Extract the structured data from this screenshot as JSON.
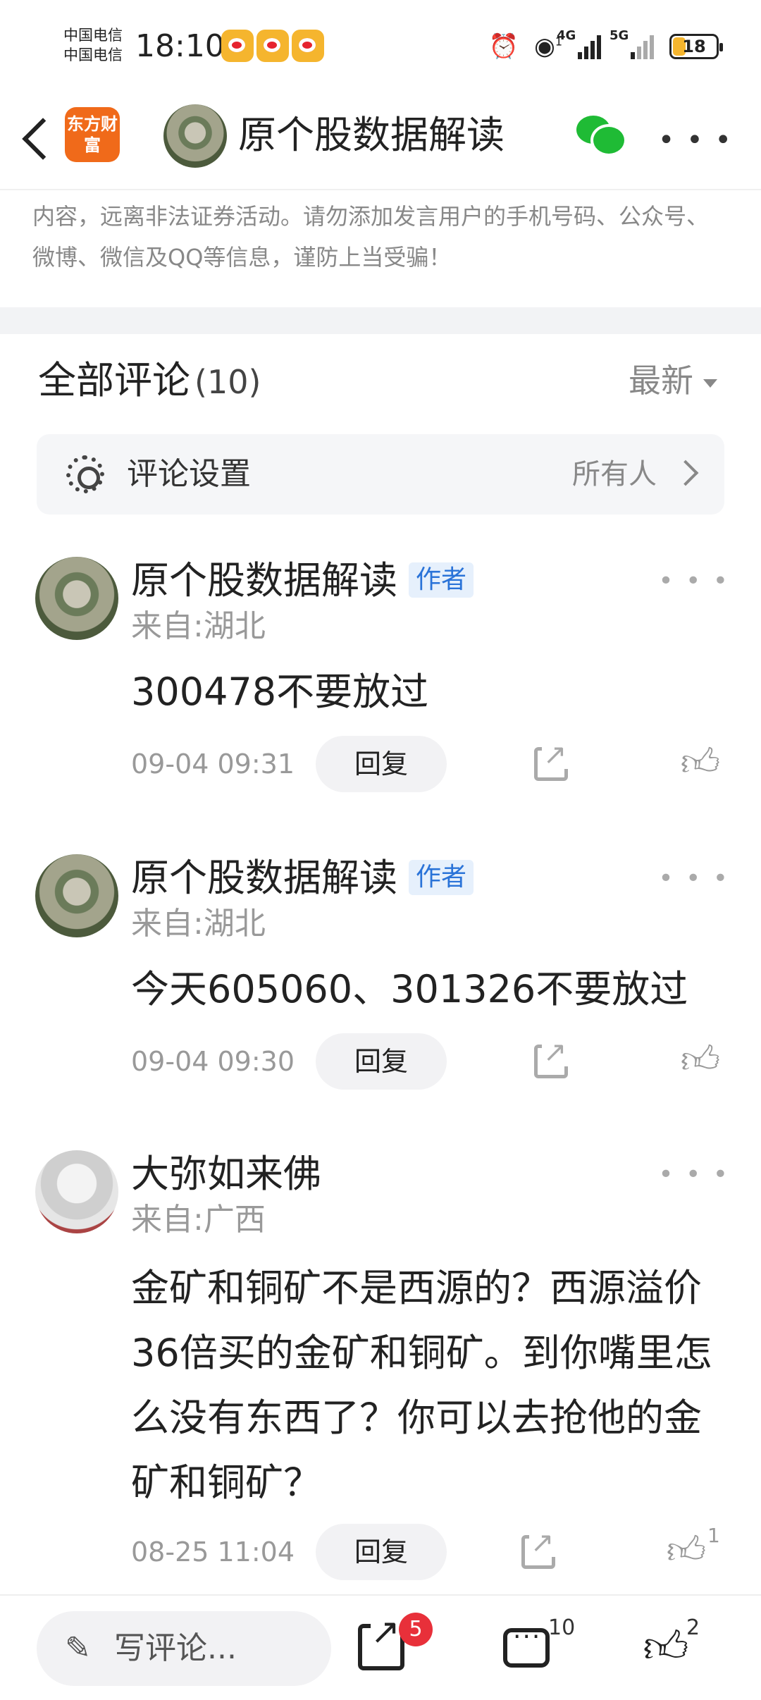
{
  "status_bar": {
    "carrier_1": "中国电信",
    "carrier_2": "中国电信",
    "time": "18:10",
    "signal_1": "4G",
    "signal_2": "5G",
    "hotspot_count": "1",
    "battery": "18"
  },
  "header": {
    "app_logo_text": "东方财富",
    "title": "原个股数据解读"
  },
  "notice": "内容，远离非法证券活动。请勿添加发言用户的手机号码、公众号、微博、微信及QQ等信息，谨防上当受骗！",
  "comments_header": {
    "title": "全部评论",
    "count": "(10)",
    "sort_label": "最新"
  },
  "comment_settings": {
    "label": "评论设置",
    "value": "所有人"
  },
  "comments": [
    {
      "author": "原个股数据解读",
      "badge": "作者",
      "location": "来自:湖北",
      "text": "300478不要放过",
      "time": "09-04 09:31",
      "reply_label": "回复",
      "likes": ""
    },
    {
      "author": "原个股数据解读",
      "badge": "作者",
      "location": "来自:湖北",
      "text": "今天605060、301326不要放过",
      "time": "09-04 09:30",
      "reply_label": "回复",
      "likes": ""
    },
    {
      "author": "大弥如来佛",
      "badge": "",
      "location": "来自:广西",
      "text": "金矿和铜矿不是西源的？西源溢价36倍买的金矿和铜矿。到你嘴里怎么没有东西了？你可以去抢他的金矿和铜矿？",
      "time": "08-25 11:04",
      "reply_label": "回复",
      "likes": "1"
    }
  ],
  "bottom_bar": {
    "write_placeholder": "写评论...",
    "share_badge": "5",
    "comment_count": "10",
    "like_count": "2"
  }
}
